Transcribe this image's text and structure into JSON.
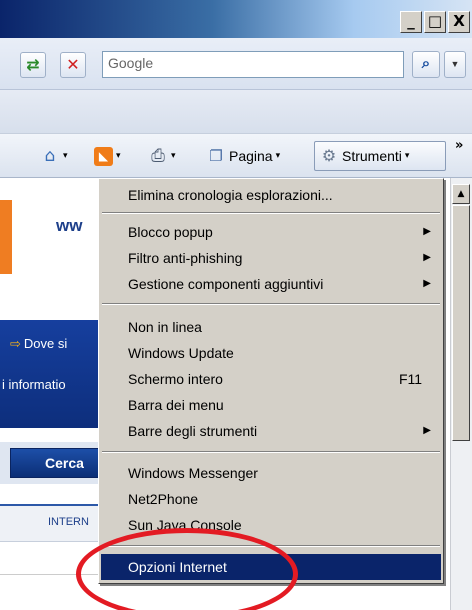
{
  "window": {
    "buttons": {
      "minimize": "_",
      "maximize": "□",
      "close": "X"
    }
  },
  "toolbar": {
    "search_placeholder": "Google",
    "refresh_glyph": "⇄",
    "stop_glyph": "✕",
    "search_go_glyph": "⌕",
    "search_options_glyph": "▼"
  },
  "commandbar": {
    "home_glyph": "⌂",
    "feeds_glyph": "◣",
    "print_glyph": "⎙",
    "page_glyph": "❐",
    "tools_glyph": "⚙",
    "dropdown_glyph": "▾",
    "pagina_label": "Pagina",
    "strumenti_label": "Strumenti",
    "overflow_glyph": "»"
  },
  "page": {
    "www_text": "ww",
    "dove_text": "Dove si",
    "dove_arrow": "⇨",
    "info_text": "i informatio",
    "cerca_text": "Cerca",
    "intern_text": "INTERN"
  },
  "scrollbar": {
    "up_glyph": "▲"
  },
  "menu": {
    "items": [
      {
        "label": "Elimina cronologia esplorazioni...",
        "shortcut": "",
        "submenu": false
      },
      {
        "label": "Blocco popup",
        "shortcut": "",
        "submenu": true
      },
      {
        "label": "Filtro anti-phishing",
        "shortcut": "",
        "submenu": true
      },
      {
        "label": "Gestione componenti aggiuntivi",
        "shortcut": "",
        "submenu": true
      },
      {
        "label": "Non in linea",
        "shortcut": "",
        "submenu": false
      },
      {
        "label": "Windows Update",
        "shortcut": "",
        "submenu": false
      },
      {
        "label": "Schermo intero",
        "shortcut": "F11",
        "submenu": false
      },
      {
        "label": "Barra dei menu",
        "shortcut": "",
        "submenu": false
      },
      {
        "label": "Barre degli strumenti",
        "shortcut": "",
        "submenu": true
      },
      {
        "label": "Windows Messenger",
        "shortcut": "",
        "submenu": false
      },
      {
        "label": "Net2Phone",
        "shortcut": "",
        "submenu": false
      },
      {
        "label": "Sun Java Console",
        "shortcut": "",
        "submenu": false
      },
      {
        "label": "Opzioni Internet",
        "shortcut": "",
        "submenu": false,
        "selected": true
      }
    ],
    "submenu_glyph": "▶"
  },
  "colors": {
    "selection": "#0a246a",
    "annotation": "#e31b23",
    "menu_bg": "#d4d0c8"
  }
}
